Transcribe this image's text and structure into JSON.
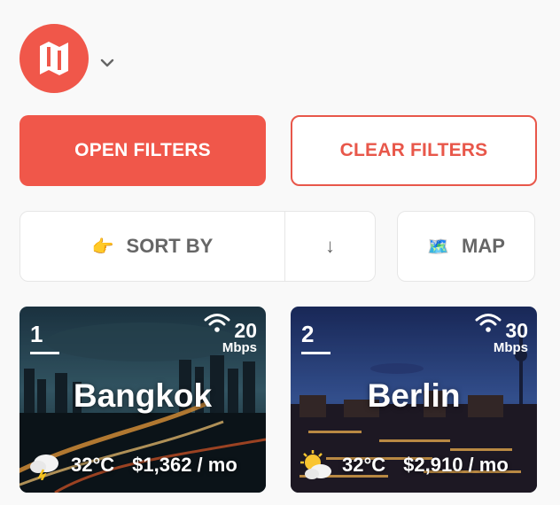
{
  "header": {
    "logo": "nomad-map-icon",
    "menu_icon": "chevron-down-icon"
  },
  "filters": {
    "open_label": "OPEN FILTERS",
    "clear_label": "CLEAR FILTERS"
  },
  "sort": {
    "emoji": "👉",
    "label": "SORT BY",
    "direction": "↓"
  },
  "map": {
    "emoji": "🗺️",
    "label": "MAP"
  },
  "colors": {
    "accent": "#f0574a",
    "muted_text": "#666666"
  },
  "cards": [
    {
      "rank": "1",
      "wifi": "20",
      "wifi_unit": "Mbps",
      "city": "Bangkok",
      "weather_icon": "cloud-thunder-icon",
      "temp": "32°C",
      "cost": "$1,362 / mo"
    },
    {
      "rank": "2",
      "wifi": "30",
      "wifi_unit": "Mbps",
      "city": "Berlin",
      "weather_icon": "sun-cloud-icon",
      "temp": "32°C",
      "cost": "$2,910 / mo"
    }
  ]
}
